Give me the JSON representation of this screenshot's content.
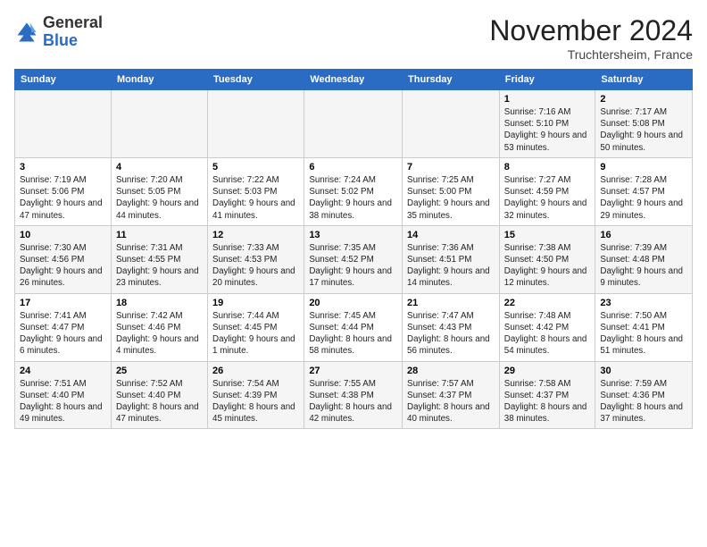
{
  "header": {
    "logo_general": "General",
    "logo_blue": "Blue",
    "month_title": "November 2024",
    "location": "Truchtersheim, France"
  },
  "days_of_week": [
    "Sunday",
    "Monday",
    "Tuesday",
    "Wednesday",
    "Thursday",
    "Friday",
    "Saturday"
  ],
  "weeks": [
    [
      {
        "day": "",
        "info": ""
      },
      {
        "day": "",
        "info": ""
      },
      {
        "day": "",
        "info": ""
      },
      {
        "day": "",
        "info": ""
      },
      {
        "day": "",
        "info": ""
      },
      {
        "day": "1",
        "info": "Sunrise: 7:16 AM\nSunset: 5:10 PM\nDaylight: 9 hours and 53 minutes."
      },
      {
        "day": "2",
        "info": "Sunrise: 7:17 AM\nSunset: 5:08 PM\nDaylight: 9 hours and 50 minutes."
      }
    ],
    [
      {
        "day": "3",
        "info": "Sunrise: 7:19 AM\nSunset: 5:06 PM\nDaylight: 9 hours and 47 minutes."
      },
      {
        "day": "4",
        "info": "Sunrise: 7:20 AM\nSunset: 5:05 PM\nDaylight: 9 hours and 44 minutes."
      },
      {
        "day": "5",
        "info": "Sunrise: 7:22 AM\nSunset: 5:03 PM\nDaylight: 9 hours and 41 minutes."
      },
      {
        "day": "6",
        "info": "Sunrise: 7:24 AM\nSunset: 5:02 PM\nDaylight: 9 hours and 38 minutes."
      },
      {
        "day": "7",
        "info": "Sunrise: 7:25 AM\nSunset: 5:00 PM\nDaylight: 9 hours and 35 minutes."
      },
      {
        "day": "8",
        "info": "Sunrise: 7:27 AM\nSunset: 4:59 PM\nDaylight: 9 hours and 32 minutes."
      },
      {
        "day": "9",
        "info": "Sunrise: 7:28 AM\nSunset: 4:57 PM\nDaylight: 9 hours and 29 minutes."
      }
    ],
    [
      {
        "day": "10",
        "info": "Sunrise: 7:30 AM\nSunset: 4:56 PM\nDaylight: 9 hours and 26 minutes."
      },
      {
        "day": "11",
        "info": "Sunrise: 7:31 AM\nSunset: 4:55 PM\nDaylight: 9 hours and 23 minutes."
      },
      {
        "day": "12",
        "info": "Sunrise: 7:33 AM\nSunset: 4:53 PM\nDaylight: 9 hours and 20 minutes."
      },
      {
        "day": "13",
        "info": "Sunrise: 7:35 AM\nSunset: 4:52 PM\nDaylight: 9 hours and 17 minutes."
      },
      {
        "day": "14",
        "info": "Sunrise: 7:36 AM\nSunset: 4:51 PM\nDaylight: 9 hours and 14 minutes."
      },
      {
        "day": "15",
        "info": "Sunrise: 7:38 AM\nSunset: 4:50 PM\nDaylight: 9 hours and 12 minutes."
      },
      {
        "day": "16",
        "info": "Sunrise: 7:39 AM\nSunset: 4:48 PM\nDaylight: 9 hours and 9 minutes."
      }
    ],
    [
      {
        "day": "17",
        "info": "Sunrise: 7:41 AM\nSunset: 4:47 PM\nDaylight: 9 hours and 6 minutes."
      },
      {
        "day": "18",
        "info": "Sunrise: 7:42 AM\nSunset: 4:46 PM\nDaylight: 9 hours and 4 minutes."
      },
      {
        "day": "19",
        "info": "Sunrise: 7:44 AM\nSunset: 4:45 PM\nDaylight: 9 hours and 1 minute."
      },
      {
        "day": "20",
        "info": "Sunrise: 7:45 AM\nSunset: 4:44 PM\nDaylight: 8 hours and 58 minutes."
      },
      {
        "day": "21",
        "info": "Sunrise: 7:47 AM\nSunset: 4:43 PM\nDaylight: 8 hours and 56 minutes."
      },
      {
        "day": "22",
        "info": "Sunrise: 7:48 AM\nSunset: 4:42 PM\nDaylight: 8 hours and 54 minutes."
      },
      {
        "day": "23",
        "info": "Sunrise: 7:50 AM\nSunset: 4:41 PM\nDaylight: 8 hours and 51 minutes."
      }
    ],
    [
      {
        "day": "24",
        "info": "Sunrise: 7:51 AM\nSunset: 4:40 PM\nDaylight: 8 hours and 49 minutes."
      },
      {
        "day": "25",
        "info": "Sunrise: 7:52 AM\nSunset: 4:40 PM\nDaylight: 8 hours and 47 minutes."
      },
      {
        "day": "26",
        "info": "Sunrise: 7:54 AM\nSunset: 4:39 PM\nDaylight: 8 hours and 45 minutes."
      },
      {
        "day": "27",
        "info": "Sunrise: 7:55 AM\nSunset: 4:38 PM\nDaylight: 8 hours and 42 minutes."
      },
      {
        "day": "28",
        "info": "Sunrise: 7:57 AM\nSunset: 4:37 PM\nDaylight: 8 hours and 40 minutes."
      },
      {
        "day": "29",
        "info": "Sunrise: 7:58 AM\nSunset: 4:37 PM\nDaylight: 8 hours and 38 minutes."
      },
      {
        "day": "30",
        "info": "Sunrise: 7:59 AM\nSunset: 4:36 PM\nDaylight: 8 hours and 37 minutes."
      }
    ]
  ]
}
